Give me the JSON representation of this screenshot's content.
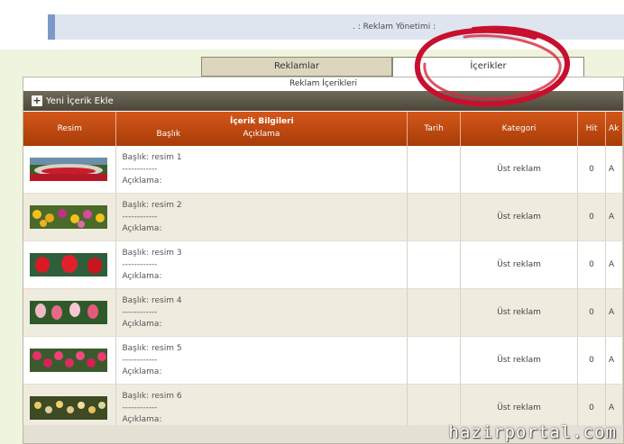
{
  "header": {
    "title": ". : Reklam Yönetimi :"
  },
  "tabs": [
    {
      "label": "Reklamlar"
    },
    {
      "label": "İçerikler"
    }
  ],
  "panel": {
    "title": "Reklam İçerikleri",
    "add_button": "Yeni İçerik Ekle"
  },
  "table": {
    "headers": {
      "resim": "Resim",
      "icerik": "İçerik Bilgileri",
      "baslik": "Başlık",
      "aciklama": "Açıklama",
      "tarih": "Tarih",
      "kategori": "Kategori",
      "hit": "Hit",
      "extra": "Ak"
    },
    "rows": [
      {
        "title": "Başlık: resim 1",
        "sep": "------------",
        "desc": "Açıklama:",
        "category": "Üst reklam",
        "hit": "0",
        "extra": "A"
      },
      {
        "title": "Başlık: resim 2",
        "sep": "------------",
        "desc": "Açıklama:",
        "category": "Üst reklam",
        "hit": "0",
        "extra": "A"
      },
      {
        "title": "Başlık: resim 3",
        "sep": "------------",
        "desc": "Açıklama:",
        "category": "Üst reklam",
        "hit": "0",
        "extra": "A"
      },
      {
        "title": "Başlık: resim 4",
        "sep": "------------",
        "desc": "Açıklama:",
        "category": "Üst reklam",
        "hit": "0",
        "extra": "A"
      },
      {
        "title": "Başlık: resim 5",
        "sep": "------------",
        "desc": "Açıklama:",
        "category": "Üst reklam",
        "hit": "0",
        "extra": "A"
      },
      {
        "title": "Başlık: resim 6",
        "sep": "------------",
        "desc": "Açıklama:",
        "category": "Üst reklam",
        "hit": "0",
        "extra": "A"
      }
    ]
  },
  "watermark": "hazirportal.com",
  "colors": {
    "header_orange": "#c44a12",
    "toolbar": "#5e5a4a",
    "annotation": "#c8102e",
    "row_alt": "#f0ebdf"
  }
}
